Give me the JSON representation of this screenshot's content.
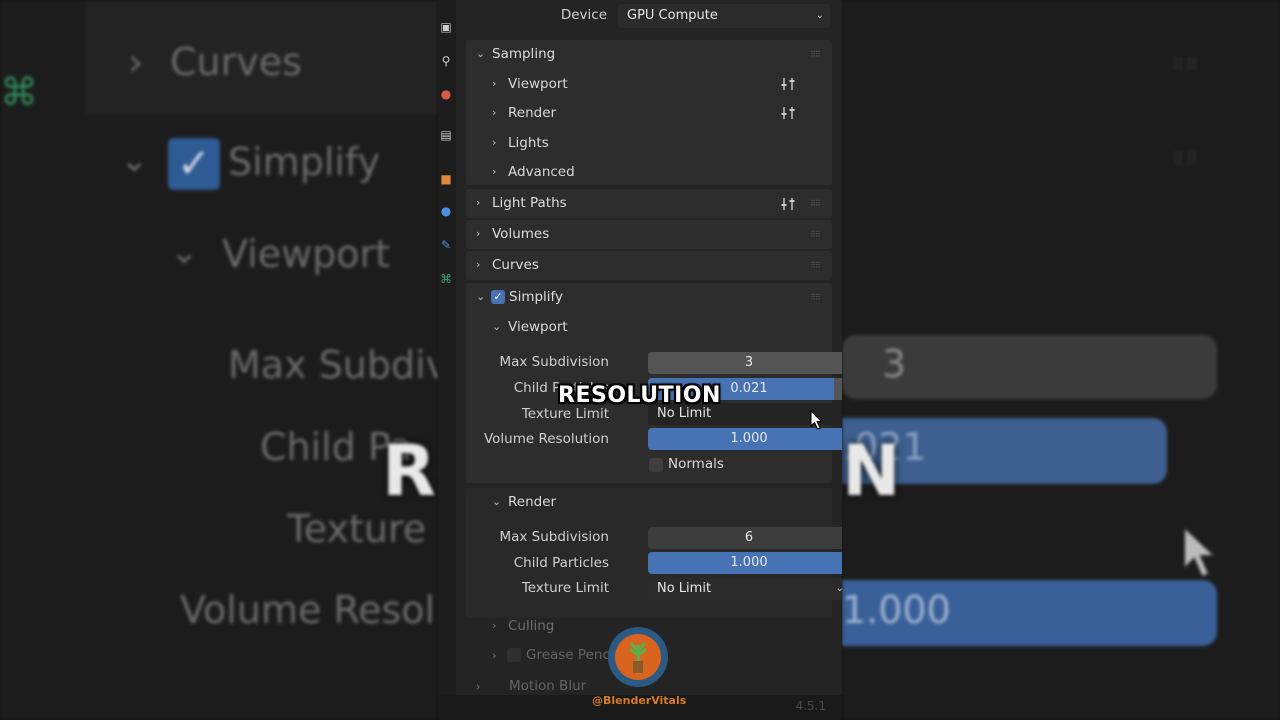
{
  "background_left": {
    "curves": "Curves",
    "simplify": "Simplify",
    "viewport": "Viewport",
    "max_subdiv": "Max Subdiv",
    "child_pa": "Child Pa",
    "texture": "Texture",
    "volume_resol": "Volume Resol"
  },
  "background_right": {
    "max_value": "3",
    "child_value": ".021",
    "volume_value": "1.000",
    "caption_fragment": "N"
  },
  "background_caption": "R",
  "device": {
    "label": "Device",
    "value": "GPU Compute"
  },
  "sections": {
    "sampling": "Sampling",
    "viewport": "Viewport",
    "render": "Render",
    "lights": "Lights",
    "advanced": "Advanced",
    "light_paths": "Light Paths",
    "volumes": "Volumes",
    "curves": "Curves",
    "simplify": "Simplify"
  },
  "simplify_viewport": {
    "title": "Viewport",
    "max_subdivision_label": "Max Subdivision",
    "max_subdivision_value": "3",
    "child_particles_label": "Child Particles",
    "child_particles_value": "0.021",
    "child_particles_fraction": 0.92,
    "texture_limit_label": "Texture Limit",
    "texture_limit_value": "No Limit",
    "volume_resolution_label": "Volume Resolution",
    "volume_resolution_value": "1.000",
    "normals_label": "Normals"
  },
  "simplify_render": {
    "title": "Render",
    "max_subdivision_label": "Max Subdivision",
    "max_subdivision_value": "6",
    "child_particles_label": "Child Particles",
    "child_particles_value": "1.000",
    "texture_limit_label": "Texture Limit",
    "texture_limit_value": "No Limit"
  },
  "lower_sections": {
    "culling": "Culling",
    "grease_pencil": "Grease Penc",
    "motion_blur": "Motion Blur"
  },
  "caption": "RESOLUTION",
  "watermark": "@BlenderVitals",
  "version": "4.5.1",
  "colors": {
    "accent_blue": "#4772b3",
    "panel_bg": "#242424",
    "header_bg": "#2d2d2d"
  }
}
